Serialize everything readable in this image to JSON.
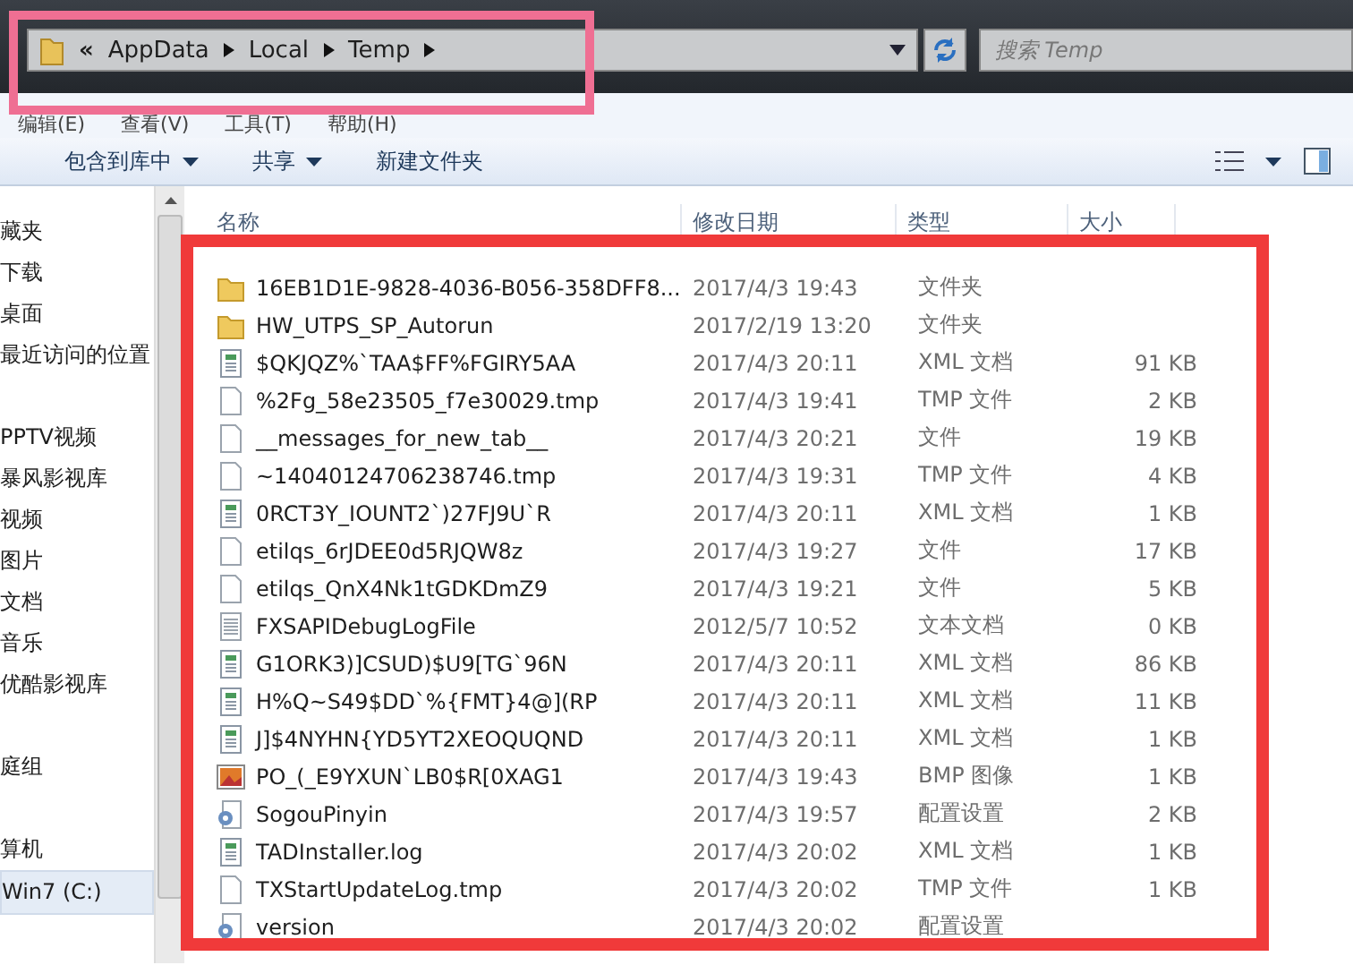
{
  "address_bar": {
    "overflow": "«",
    "crumbs": [
      "AppData",
      "Local",
      "Temp"
    ]
  },
  "search": {
    "placeholder": "搜索 Temp"
  },
  "menu": [
    "编辑(E)",
    "查看(V)",
    "工具(T)",
    "帮助(H)"
  ],
  "toolbar": [
    "包含到库中",
    "共享",
    "新建文件夹"
  ],
  "sidebar": {
    "groups": [
      [
        {
          "label": "藏夹",
          "selected": false
        },
        {
          "label": "下载",
          "selected": false
        },
        {
          "label": "桌面",
          "selected": false
        },
        {
          "label": "最近访问的位置",
          "selected": false
        }
      ],
      [
        {
          "label": "PPTV视频",
          "selected": false
        },
        {
          "label": "暴风影视库",
          "selected": false
        },
        {
          "label": "视频",
          "selected": false
        },
        {
          "label": "图片",
          "selected": false
        },
        {
          "label": "文档",
          "selected": false
        },
        {
          "label": "音乐",
          "selected": false
        },
        {
          "label": "优酷影视库",
          "selected": false
        }
      ],
      [
        {
          "label": "庭组",
          "selected": false
        }
      ],
      [
        {
          "label": "算机",
          "selected": false
        },
        {
          "label": "Win7 (C:)",
          "selected": true
        }
      ]
    ]
  },
  "table": {
    "columns": [
      "名称",
      "修改日期",
      "类型",
      "大小"
    ],
    "rows": [
      {
        "kind": "folder",
        "name": "16EB1D1E-9828-4036-B056-358DFF8...",
        "date": "2017/4/3 19:43",
        "type": "文件夹",
        "size": ""
      },
      {
        "kind": "folder",
        "name": "HW_UTPS_SP_Autorun",
        "date": "2017/2/19 13:20",
        "type": "文件夹",
        "size": ""
      },
      {
        "kind": "xml",
        "name": "$QKJQZ%`TAA$FF%FGIRY5AA",
        "date": "2017/4/3 20:11",
        "type": "XML 文档",
        "size": "91 KB"
      },
      {
        "kind": "file",
        "name": "%2Fg_58e23505_f7e30029.tmp",
        "date": "2017/4/3 19:41",
        "type": "TMP 文件",
        "size": "2 KB"
      },
      {
        "kind": "file",
        "name": "__messages_for_new_tab__",
        "date": "2017/4/3 20:21",
        "type": "文件",
        "size": "19 KB"
      },
      {
        "kind": "file",
        "name": "~14040124706238746.tmp",
        "date": "2017/4/3 19:31",
        "type": "TMP 文件",
        "size": "4 KB"
      },
      {
        "kind": "xml",
        "name": "0RCT3Y_IOUNT2`)27FJ9U`R",
        "date": "2017/4/3 20:11",
        "type": "XML 文档",
        "size": "1 KB"
      },
      {
        "kind": "file",
        "name": "etilqs_6rJDEE0d5RJQW8z",
        "date": "2017/4/3 19:27",
        "type": "文件",
        "size": "17 KB"
      },
      {
        "kind": "file",
        "name": "etilqs_QnX4Nk1tGDKDmZ9",
        "date": "2017/4/3 19:21",
        "type": "文件",
        "size": "5 KB"
      },
      {
        "kind": "text",
        "name": "FXSAPIDebugLogFile",
        "date": "2012/5/7 10:52",
        "type": "文本文档",
        "size": "0 KB"
      },
      {
        "kind": "xml",
        "name": "G1ORK3)]CSUD)$U9[TG`96N",
        "date": "2017/4/3 20:11",
        "type": "XML 文档",
        "size": "86 KB"
      },
      {
        "kind": "xml",
        "name": "H%Q~S49$DD`%{FMT}4@](RP",
        "date": "2017/4/3 20:11",
        "type": "XML 文档",
        "size": "11 KB"
      },
      {
        "kind": "xml",
        "name": "J]$4NYHN{YD5YT2XEOQUQND",
        "date": "2017/4/3 20:11",
        "type": "XML 文档",
        "size": "1 KB"
      },
      {
        "kind": "image",
        "name": "PO_(_E9YXUN`LB0$R[0XAG1",
        "date": "2017/4/3 19:43",
        "type": "BMP 图像",
        "size": "1 KB"
      },
      {
        "kind": "config",
        "name": "SogouPinyin",
        "date": "2017/4/3 19:57",
        "type": "配置设置",
        "size": "2 KB"
      },
      {
        "kind": "xml",
        "name": "TADInstaller.log",
        "date": "2017/4/3 20:02",
        "type": "XML 文档",
        "size": "1 KB"
      },
      {
        "kind": "file",
        "name": "TXStartUpdateLog.tmp",
        "date": "2017/4/3 20:02",
        "type": "TMP 文件",
        "size": "1 KB"
      },
      {
        "kind": "config",
        "name": "version",
        "date": "2017/4/3 20:02",
        "type": "配置设置",
        "size": ""
      }
    ]
  }
}
